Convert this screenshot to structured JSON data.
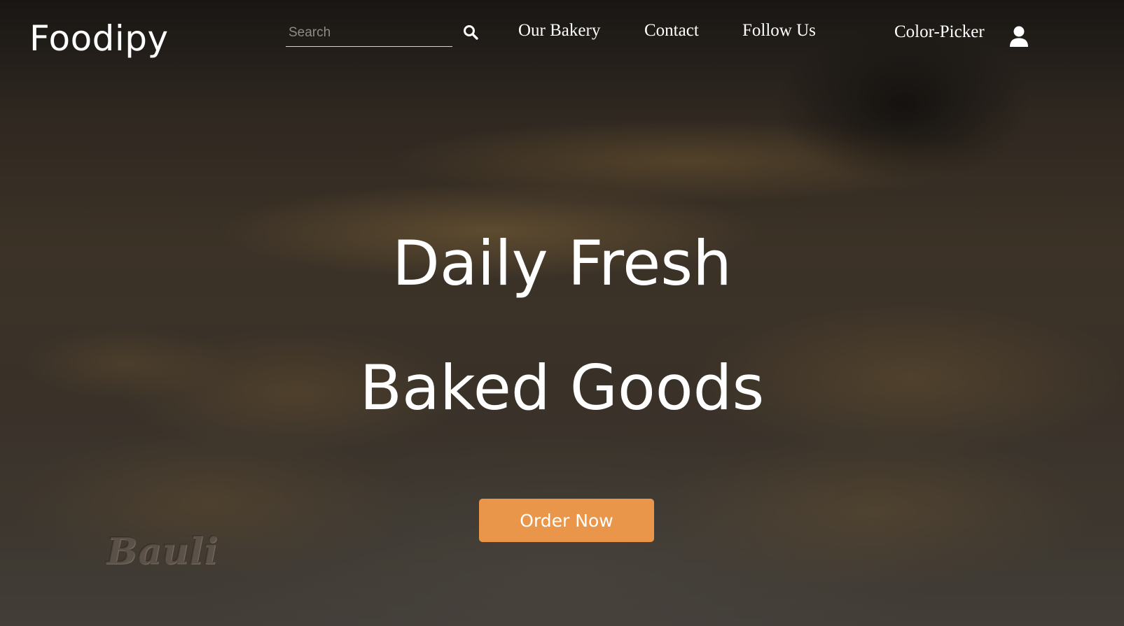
{
  "brand": {
    "logo_text": "Foodipy"
  },
  "search": {
    "placeholder": "Search",
    "value": ""
  },
  "nav": {
    "items": [
      {
        "label": "Our Bakery"
      },
      {
        "label": "Contact"
      },
      {
        "label": "Follow Us"
      },
      {
        "label": "Color-Picker"
      }
    ]
  },
  "icons": {
    "search": "search-icon",
    "user": "user-icon"
  },
  "hero": {
    "line1": "Daily Fresh",
    "line2": "Baked Goods",
    "cta_label": "Order Now",
    "watermark": "Bauli"
  },
  "colors": {
    "accent": "#e9964a",
    "text": "#ffffff"
  }
}
